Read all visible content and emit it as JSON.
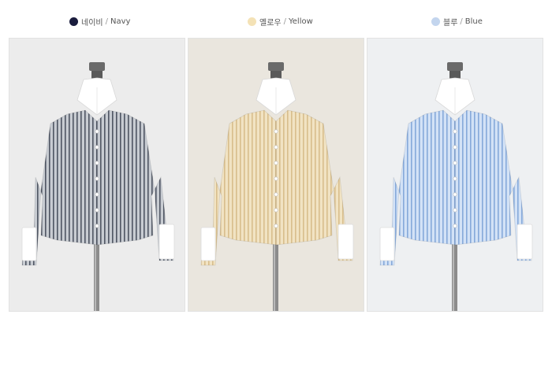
{
  "variants": [
    {
      "korean": "네이비",
      "english": "Navy",
      "swatch": "#1a1c3d",
      "shirt_base": "#c8ccd2",
      "stripe": "#4f5663",
      "bg": "#ececec"
    },
    {
      "korean": "옐로우",
      "english": "Yellow",
      "swatch": "#f4e2b6",
      "shirt_base": "#f1e3c3",
      "stripe": "#d8be8c",
      "bg": "#eae6de"
    },
    {
      "korean": "블루",
      "english": "Blue",
      "swatch": "#c3d5ee",
      "shirt_base": "#d3e2f6",
      "stripe": "#86a9da",
      "bg": "#eef0f2"
    }
  ],
  "separator": "/"
}
